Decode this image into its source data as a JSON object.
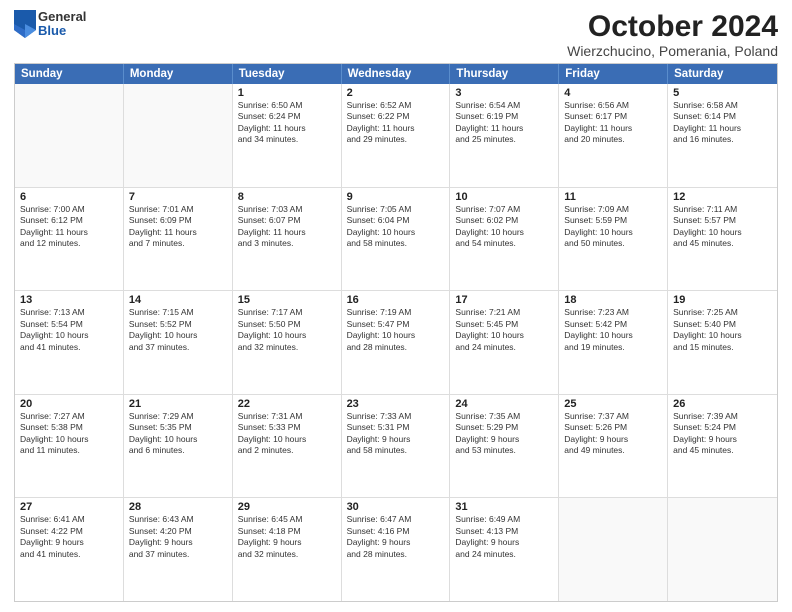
{
  "header": {
    "logo_general": "General",
    "logo_blue": "Blue",
    "title": "October 2024",
    "subtitle": "Wierzchucino, Pomerania, Poland"
  },
  "calendar": {
    "days_of_week": [
      "Sunday",
      "Monday",
      "Tuesday",
      "Wednesday",
      "Thursday",
      "Friday",
      "Saturday"
    ],
    "weeks": [
      [
        {
          "day": "",
          "info": "",
          "empty": true
        },
        {
          "day": "",
          "info": "",
          "empty": true
        },
        {
          "day": "1",
          "info": "Sunrise: 6:50 AM\nSunset: 6:24 PM\nDaylight: 11 hours\nand 34 minutes.",
          "empty": false
        },
        {
          "day": "2",
          "info": "Sunrise: 6:52 AM\nSunset: 6:22 PM\nDaylight: 11 hours\nand 29 minutes.",
          "empty": false
        },
        {
          "day": "3",
          "info": "Sunrise: 6:54 AM\nSunset: 6:19 PM\nDaylight: 11 hours\nand 25 minutes.",
          "empty": false
        },
        {
          "day": "4",
          "info": "Sunrise: 6:56 AM\nSunset: 6:17 PM\nDaylight: 11 hours\nand 20 minutes.",
          "empty": false
        },
        {
          "day": "5",
          "info": "Sunrise: 6:58 AM\nSunset: 6:14 PM\nDaylight: 11 hours\nand 16 minutes.",
          "empty": false
        }
      ],
      [
        {
          "day": "6",
          "info": "Sunrise: 7:00 AM\nSunset: 6:12 PM\nDaylight: 11 hours\nand 12 minutes.",
          "empty": false
        },
        {
          "day": "7",
          "info": "Sunrise: 7:01 AM\nSunset: 6:09 PM\nDaylight: 11 hours\nand 7 minutes.",
          "empty": false
        },
        {
          "day": "8",
          "info": "Sunrise: 7:03 AM\nSunset: 6:07 PM\nDaylight: 11 hours\nand 3 minutes.",
          "empty": false
        },
        {
          "day": "9",
          "info": "Sunrise: 7:05 AM\nSunset: 6:04 PM\nDaylight: 10 hours\nand 58 minutes.",
          "empty": false
        },
        {
          "day": "10",
          "info": "Sunrise: 7:07 AM\nSunset: 6:02 PM\nDaylight: 10 hours\nand 54 minutes.",
          "empty": false
        },
        {
          "day": "11",
          "info": "Sunrise: 7:09 AM\nSunset: 5:59 PM\nDaylight: 10 hours\nand 50 minutes.",
          "empty": false
        },
        {
          "day": "12",
          "info": "Sunrise: 7:11 AM\nSunset: 5:57 PM\nDaylight: 10 hours\nand 45 minutes.",
          "empty": false
        }
      ],
      [
        {
          "day": "13",
          "info": "Sunrise: 7:13 AM\nSunset: 5:54 PM\nDaylight: 10 hours\nand 41 minutes.",
          "empty": false
        },
        {
          "day": "14",
          "info": "Sunrise: 7:15 AM\nSunset: 5:52 PM\nDaylight: 10 hours\nand 37 minutes.",
          "empty": false
        },
        {
          "day": "15",
          "info": "Sunrise: 7:17 AM\nSunset: 5:50 PM\nDaylight: 10 hours\nand 32 minutes.",
          "empty": false
        },
        {
          "day": "16",
          "info": "Sunrise: 7:19 AM\nSunset: 5:47 PM\nDaylight: 10 hours\nand 28 minutes.",
          "empty": false
        },
        {
          "day": "17",
          "info": "Sunrise: 7:21 AM\nSunset: 5:45 PM\nDaylight: 10 hours\nand 24 minutes.",
          "empty": false
        },
        {
          "day": "18",
          "info": "Sunrise: 7:23 AM\nSunset: 5:42 PM\nDaylight: 10 hours\nand 19 minutes.",
          "empty": false
        },
        {
          "day": "19",
          "info": "Sunrise: 7:25 AM\nSunset: 5:40 PM\nDaylight: 10 hours\nand 15 minutes.",
          "empty": false
        }
      ],
      [
        {
          "day": "20",
          "info": "Sunrise: 7:27 AM\nSunset: 5:38 PM\nDaylight: 10 hours\nand 11 minutes.",
          "empty": false
        },
        {
          "day": "21",
          "info": "Sunrise: 7:29 AM\nSunset: 5:35 PM\nDaylight: 10 hours\nand 6 minutes.",
          "empty": false
        },
        {
          "day": "22",
          "info": "Sunrise: 7:31 AM\nSunset: 5:33 PM\nDaylight: 10 hours\nand 2 minutes.",
          "empty": false
        },
        {
          "day": "23",
          "info": "Sunrise: 7:33 AM\nSunset: 5:31 PM\nDaylight: 9 hours\nand 58 minutes.",
          "empty": false
        },
        {
          "day": "24",
          "info": "Sunrise: 7:35 AM\nSunset: 5:29 PM\nDaylight: 9 hours\nand 53 minutes.",
          "empty": false
        },
        {
          "day": "25",
          "info": "Sunrise: 7:37 AM\nSunset: 5:26 PM\nDaylight: 9 hours\nand 49 minutes.",
          "empty": false
        },
        {
          "day": "26",
          "info": "Sunrise: 7:39 AM\nSunset: 5:24 PM\nDaylight: 9 hours\nand 45 minutes.",
          "empty": false
        }
      ],
      [
        {
          "day": "27",
          "info": "Sunrise: 6:41 AM\nSunset: 4:22 PM\nDaylight: 9 hours\nand 41 minutes.",
          "empty": false
        },
        {
          "day": "28",
          "info": "Sunrise: 6:43 AM\nSunset: 4:20 PM\nDaylight: 9 hours\nand 37 minutes.",
          "empty": false
        },
        {
          "day": "29",
          "info": "Sunrise: 6:45 AM\nSunset: 4:18 PM\nDaylight: 9 hours\nand 32 minutes.",
          "empty": false
        },
        {
          "day": "30",
          "info": "Sunrise: 6:47 AM\nSunset: 4:16 PM\nDaylight: 9 hours\nand 28 minutes.",
          "empty": false
        },
        {
          "day": "31",
          "info": "Sunrise: 6:49 AM\nSunset: 4:13 PM\nDaylight: 9 hours\nand 24 minutes.",
          "empty": false
        },
        {
          "day": "",
          "info": "",
          "empty": true
        },
        {
          "day": "",
          "info": "",
          "empty": true
        }
      ]
    ]
  }
}
